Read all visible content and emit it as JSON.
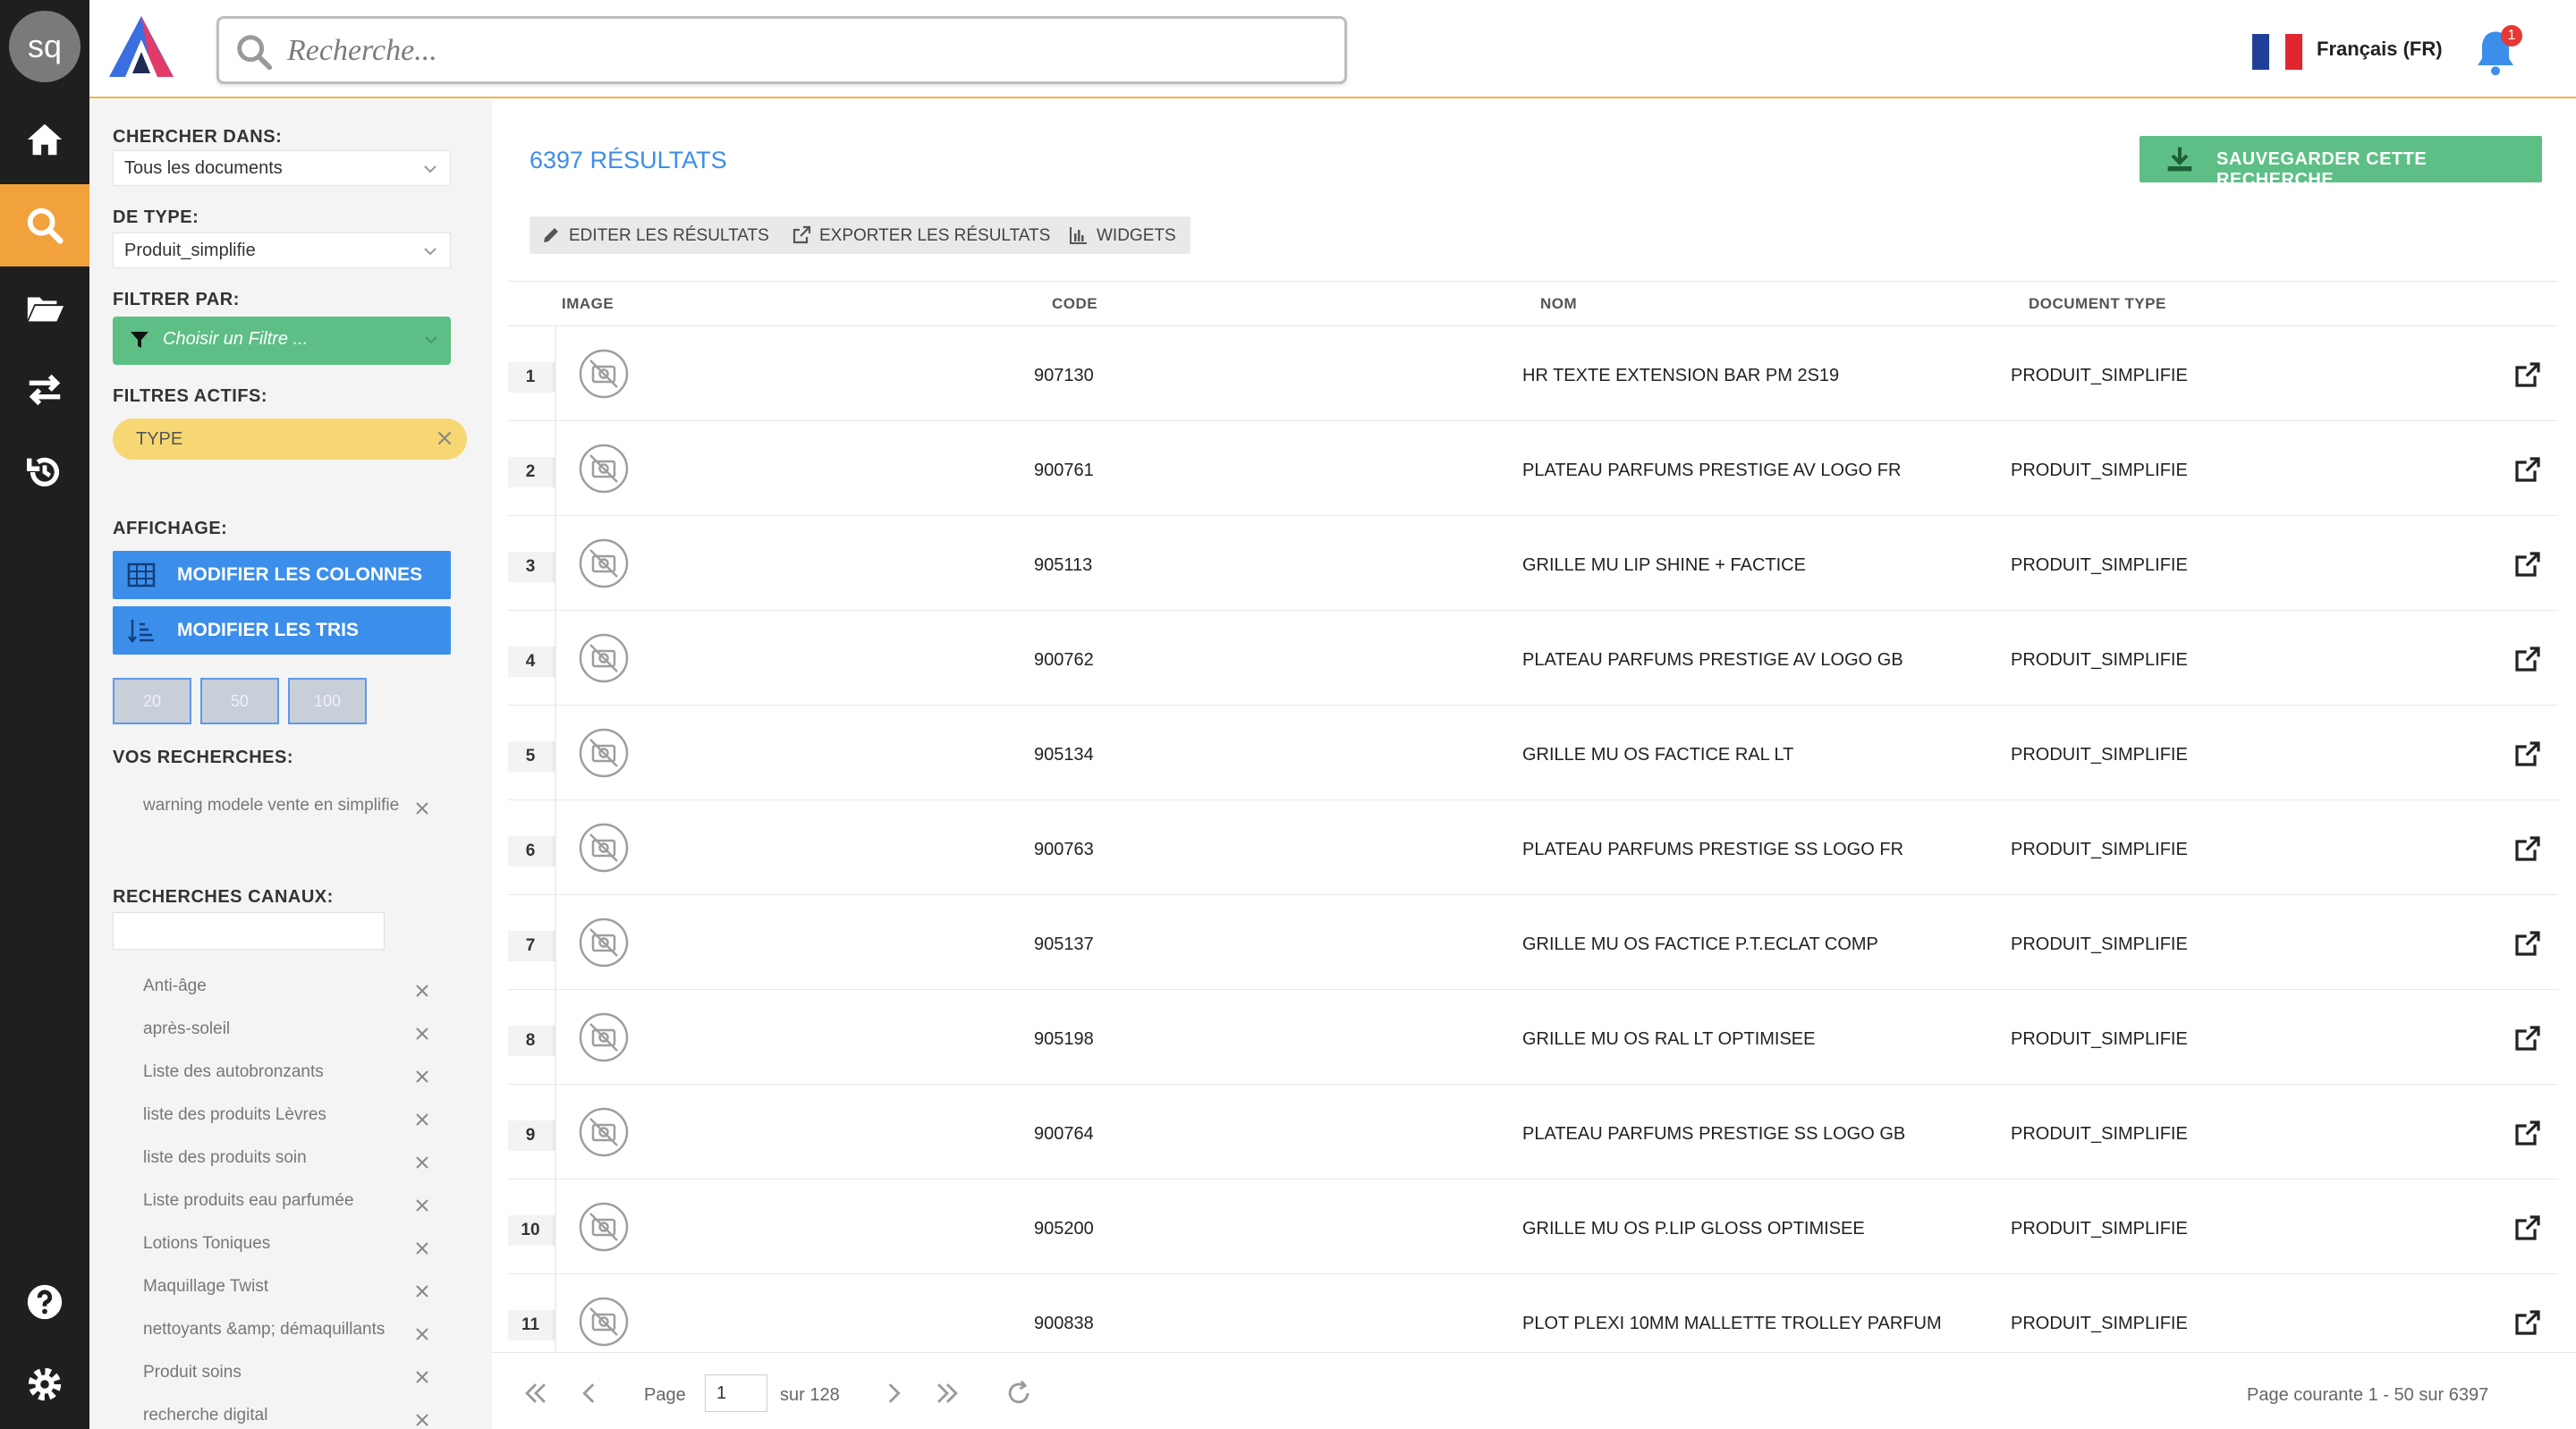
{
  "user": {
    "initials": "sq"
  },
  "search": {
    "placeholder": "Recherche..."
  },
  "language": {
    "label": "Français (FR)"
  },
  "notifications": {
    "count": "1"
  },
  "panel": {
    "chercher_dans": {
      "label": "CHERCHER DANS:",
      "value": "Tous les documents"
    },
    "de_type": {
      "label": "DE TYPE:",
      "value": "Produit_simplifie"
    },
    "filtrer_par": {
      "label": "FILTRER PAR:",
      "placeholder": "Choisir un Filtre ..."
    },
    "filtres_actifs": {
      "label": "FILTRES ACTIFS:",
      "chip": "TYPE"
    },
    "affichage": {
      "label": "AFFICHAGE:",
      "columns_button": "MODIFIER LES COLONNES",
      "sorts_button": "MODIFIER LES TRIS",
      "page_sizes": [
        "20",
        "50",
        "100"
      ]
    },
    "vos_recherches": {
      "label": "VOS RECHERCHES:",
      "items": [
        "warning modele vente en simplifie"
      ]
    },
    "recherches_canaux": {
      "label": "RECHERCHES CANAUX:",
      "items": [
        "Anti-âge",
        "après-soleil",
        "Liste des autobronzants",
        "liste des produits Lèvres",
        "liste des produits soin",
        "Liste produits eau parfumée",
        "Lotions Toniques",
        "Maquillage Twist",
        "nettoyants &amp; démaquillants",
        "Produit soins",
        "recherche digital"
      ]
    }
  },
  "main": {
    "results_count": "6397 RÉSULTATS",
    "save_button": "SAUVEGARDER CETTE RECHERCHE",
    "toolbar": {
      "edit": "EDITER LES RÉSULTATS",
      "export": "EXPORTER LES RÉSULTATS",
      "widgets": "WIDGETS"
    },
    "columns": {
      "image": "IMAGE",
      "code": "CODE",
      "nom": "NOM",
      "doc_type": "DOCUMENT TYPE"
    },
    "rows": [
      {
        "n": "1",
        "code": "907130",
        "nom": "HR TEXTE EXTENSION BAR PM 2S19",
        "type": "PRODUIT_SIMPLIFIE"
      },
      {
        "n": "2",
        "code": "900761",
        "nom": "PLATEAU PARFUMS PRESTIGE AV LOGO FR",
        "type": "PRODUIT_SIMPLIFIE"
      },
      {
        "n": "3",
        "code": "905113",
        "nom": "GRILLE MU LIP SHINE + FACTICE",
        "type": "PRODUIT_SIMPLIFIE"
      },
      {
        "n": "4",
        "code": "900762",
        "nom": "PLATEAU PARFUMS PRESTIGE AV LOGO GB",
        "type": "PRODUIT_SIMPLIFIE"
      },
      {
        "n": "5",
        "code": "905134",
        "nom": "GRILLE MU OS FACTICE RAL LT",
        "type": "PRODUIT_SIMPLIFIE"
      },
      {
        "n": "6",
        "code": "900763",
        "nom": "PLATEAU PARFUMS PRESTIGE SS LOGO FR",
        "type": "PRODUIT_SIMPLIFIE"
      },
      {
        "n": "7",
        "code": "905137",
        "nom": "GRILLE MU OS FACTICE P.T.ECLAT COMP",
        "type": "PRODUIT_SIMPLIFIE"
      },
      {
        "n": "8",
        "code": "905198",
        "nom": "GRILLE MU OS RAL LT OPTIMISEE",
        "type": "PRODUIT_SIMPLIFIE"
      },
      {
        "n": "9",
        "code": "900764",
        "nom": "PLATEAU PARFUMS PRESTIGE SS LOGO GB",
        "type": "PRODUIT_SIMPLIFIE"
      },
      {
        "n": "10",
        "code": "905200",
        "nom": "GRILLE MU OS P.LIP GLOSS OPTIMISEE",
        "type": "PRODUIT_SIMPLIFIE"
      },
      {
        "n": "11",
        "code": "900838",
        "nom": "PLOT PLEXI 10MM MALLETTE TROLLEY PARFUM",
        "type": "PRODUIT_SIMPLIFIE"
      }
    ],
    "pager": {
      "page_label": "Page",
      "current_page": "1",
      "of_label": "sur 128",
      "summary": "Page courante 1 - 50 sur 6397"
    }
  },
  "colors": {
    "accent_orange": "#f2a23c",
    "accent_blue": "#3b8eea",
    "accent_green": "#5dbf85",
    "chip_yellow": "#f7d774",
    "rail_dark": "#1f1f1f"
  }
}
